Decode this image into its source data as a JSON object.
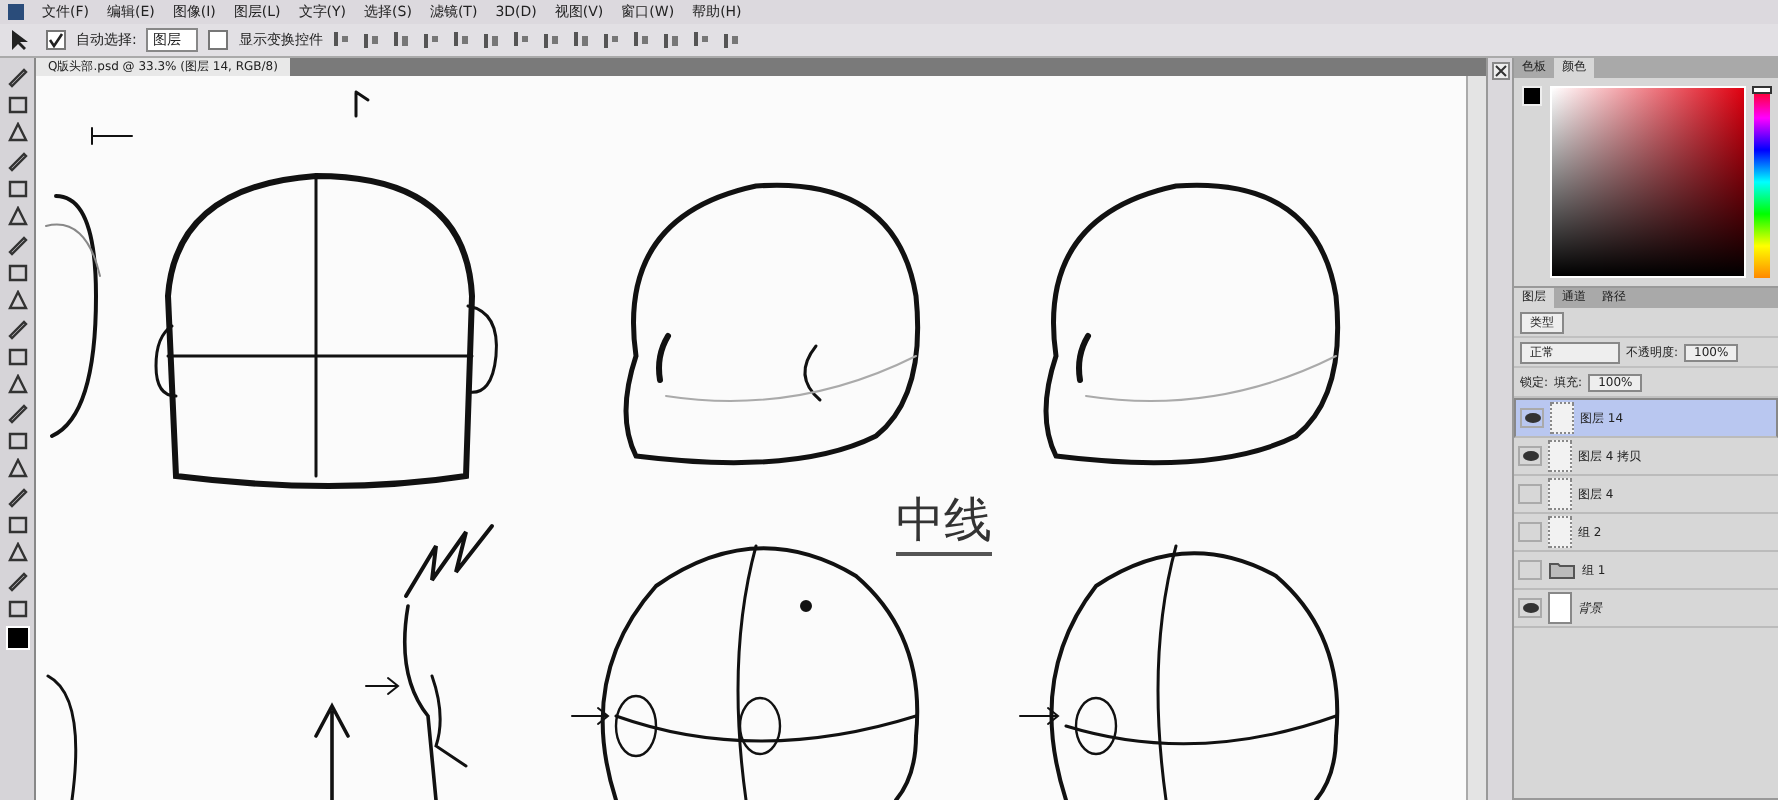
{
  "menu_bar": {
    "items": [
      "文件(F)",
      "编辑(E)",
      "图像(I)",
      "图层(L)",
      "文字(Y)",
      "选择(S)",
      "滤镜(T)",
      "3D(D)",
      "视图(V)",
      "窗口(W)",
      "帮助(H)"
    ]
  },
  "options_bar": {
    "auto_select_label": "自动选择:",
    "auto_select_checked": true,
    "target": "图层",
    "show_transform_label": "显示变换控件",
    "show_transform_checked": false
  },
  "document_tab": {
    "title": "Q版头部.psd @ 33.3% (图层 14, RGB/8)"
  },
  "canvas": {
    "annotation": "中线"
  },
  "color_panel": {
    "tabs": [
      {
        "label": "色板",
        "selected": false
      },
      {
        "label": "颜色",
        "selected": true
      }
    ],
    "hue_slider": {
      "level": 0.98
    }
  },
  "layers_panel": {
    "tabs": [
      {
        "label": "图层",
        "selected": true
      },
      {
        "label": "通道",
        "selected": false
      },
      {
        "label": "路径",
        "selected": false
      }
    ],
    "filter": "类型",
    "blend_mode": "正常",
    "opacity_label": "不透明度:",
    "opacity": "100%",
    "lock_label": "锁定:",
    "fill_label": "填充:",
    "fill": "100%",
    "layers": [
      {
        "name": "图层 14",
        "kind": "layer",
        "visible": true,
        "selected": true
      },
      {
        "name": "图层 4 拷贝",
        "kind": "layer",
        "visible": true,
        "selected": false
      },
      {
        "name": "图层 4",
        "kind": "layer",
        "visible": false,
        "selected": false
      },
      {
        "name": "组 2",
        "kind": "layer",
        "visible": false,
        "selected": false
      },
      {
        "name": "组 1",
        "kind": "group",
        "visible": false,
        "selected": false
      },
      {
        "name": "背景",
        "kind": "background",
        "visible": true,
        "selected": false
      }
    ]
  }
}
